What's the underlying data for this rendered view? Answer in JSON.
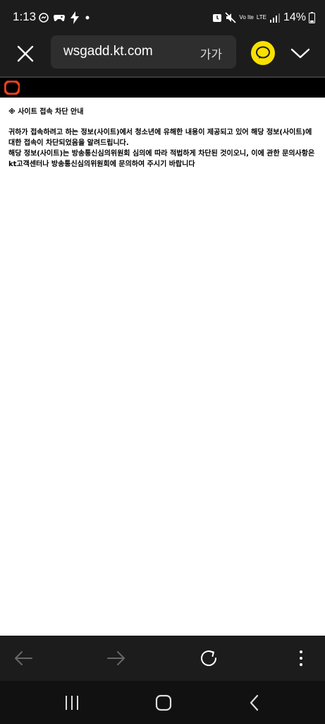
{
  "status_bar": {
    "time": "1:13",
    "battery": "14%",
    "lte_top": "LTE",
    "volte": "Vo Ite",
    "icons": [
      "messenger-icon",
      "game-controller-icon",
      "bolt-icon",
      "dot-icon",
      "alarm-icon",
      "mute-icon",
      "lte-signal-icon",
      "battery-icon"
    ]
  },
  "browser": {
    "url": "wsgadd.kt.com",
    "text_size_label": "가가",
    "icons": [
      "close-icon",
      "kakaotalk-icon",
      "chevron-down-icon"
    ]
  },
  "page": {
    "title": "※ 사이트 접속 차단 안내",
    "paragraph1": "귀하가 접속하려고 하는 정보(사이트)에서 청소년에 유해한 내용이 제공되고 있어 해당 정보(사이트)에 대한 접속이 차단되었음을 알려드립니다.",
    "paragraph2": "해당 정보(사이트)는 방송통신심의위원회 심의에 따라 적법하게 차단된 것이오니, 이에 관한 문의사항은 kt고객센터나 방송통신심의위원회에 문의하여 주시기 바랍니다"
  },
  "toolbar": {
    "icons": [
      "back-arrow-icon",
      "forward-arrow-icon",
      "refresh-icon",
      "more-vertical-icon"
    ]
  },
  "navigation": {
    "icons": [
      "recent-apps-icon",
      "home-icon",
      "back-icon"
    ]
  },
  "colors": {
    "chrome_bg": "#1c1c1c",
    "url_field_bg": "#2e2e2e",
    "kakao_yellow": "#f9e000",
    "olleh_red": "#e8401c"
  }
}
